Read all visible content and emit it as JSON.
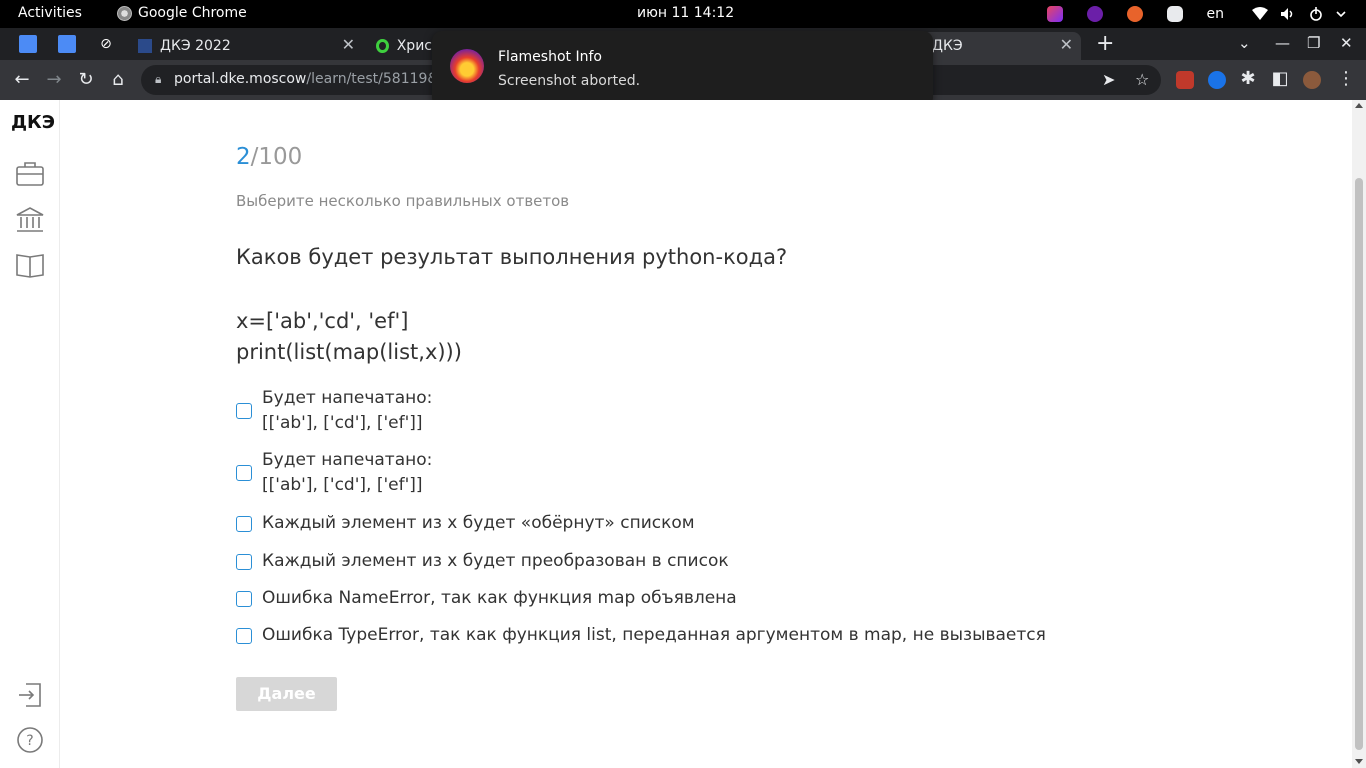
{
  "os_bar": {
    "activities": "Activities",
    "app_name": "Google Chrome",
    "clock": "июн 11  14:12",
    "lang": "en"
  },
  "browser": {
    "tabs": [
      {
        "title": "ДКЭ 2022"
      },
      {
        "title": "Хрис"
      },
      {
        "title": "ДКЭ"
      }
    ],
    "new_tab": "+",
    "url_host": "portal.dke.moscow",
    "url_path": "/learn/test/58119&exe"
  },
  "notification": {
    "title": "Flameshot Info",
    "body": "Screenshot aborted."
  },
  "sidebar": {
    "brand": "ДКЭ"
  },
  "test": {
    "current": "2",
    "total": "/100",
    "hint": "Выберите несколько правильных ответов",
    "question": "Каков будет результат выполнения python-кода?",
    "code_lines": [
      "x=['ab','cd', 'ef']",
      "print(list(map(list,x)))"
    ],
    "options": [
      {
        "line1": "Будет напечатано:",
        "line2": "[['ab'], ['cd'], ['ef']]"
      },
      {
        "line1": "Будет напечатано:",
        "line2": "[['ab'], ['cd'], ['ef']]"
      },
      {
        "line1": "Каждый элемент из x будет «обёрнут» списком"
      },
      {
        "line1": "Каждый элемент из x будет преобразован в список"
      },
      {
        "line1": "Ошибка NameError, так как функция map объявлена"
      },
      {
        "line1": "Ошибка TypeError, так как функция list, переданная аргументом в map, не вызывается"
      }
    ],
    "next_button": "Далее"
  },
  "colors": {
    "accent": "#2b8fd6",
    "button_disabled": "#d7d7d7"
  }
}
